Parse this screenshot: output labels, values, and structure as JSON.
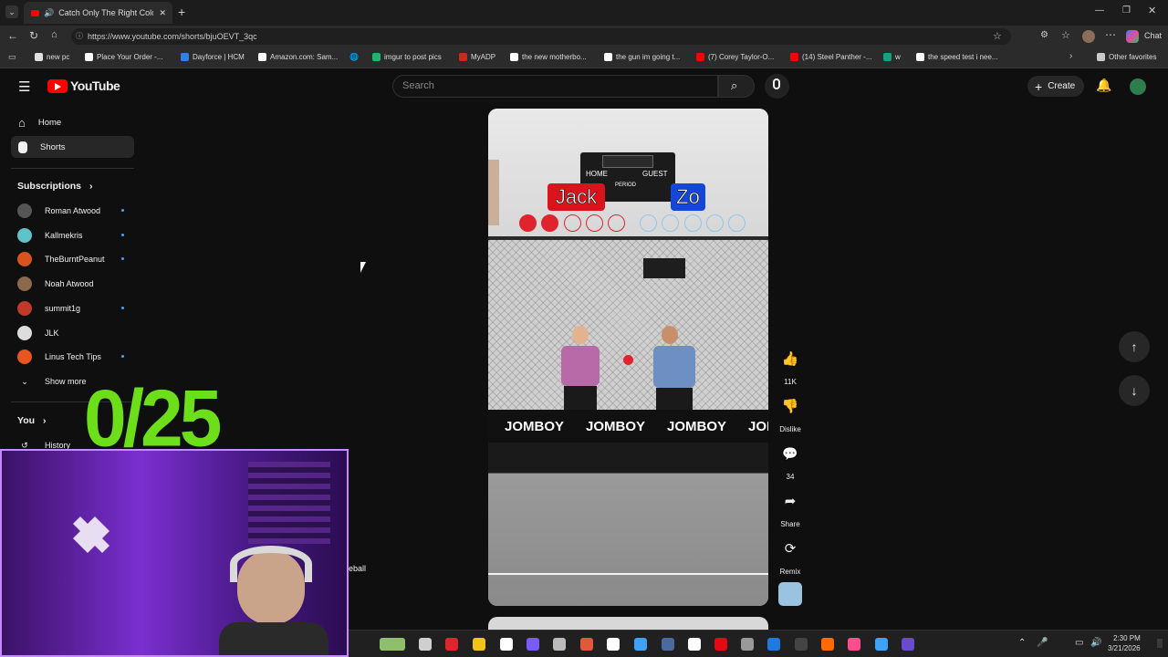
{
  "browser": {
    "tab_title": "Catch Only The Right Color B",
    "url": "https://www.youtube.com/shorts/bjuOEVT_3qc",
    "copilot_label": "Chat",
    "bookmarks": [
      {
        "label": "new pc",
        "color": "#e0e0e0"
      },
      {
        "label": "Place Your Order -...",
        "color": "#ffffff"
      },
      {
        "label": "Dayforce | HCM",
        "color": "#2f80ed"
      },
      {
        "label": "Amazon.com: Sam...",
        "color": "#ffffff"
      },
      {
        "label": "imgur to post pics",
        "color": "#1bb76e"
      },
      {
        "label": "MyADP",
        "color": "#d0271d"
      },
      {
        "label": "the new motherbo...",
        "color": "#ffffff"
      },
      {
        "label": "the gun im going t...",
        "color": "#ffffff"
      },
      {
        "label": "(7) Corey Taylor-O...",
        "color": "#ff0000"
      },
      {
        "label": "(14) Steel Panther -...",
        "color": "#ff0000"
      },
      {
        "label": "w",
        "color": "#10a37f"
      },
      {
        "label": "the speed test i nee...",
        "color": "#ffffff"
      }
    ],
    "other_favorites": "Other favorites"
  },
  "youtube": {
    "logo_text": "YouTube",
    "search_placeholder": "Search",
    "create_label": "Create",
    "sidebar": {
      "home": "Home",
      "shorts": "Shorts",
      "subscriptions_label": "Subscriptions",
      "subscriptions": [
        {
          "name": "Roman Atwood",
          "color": "#555555",
          "new": true
        },
        {
          "name": "Kallmekris",
          "color": "#5fc3c9",
          "new": true
        },
        {
          "name": "TheBurntPeanut",
          "color": "#d9531e",
          "new": true
        },
        {
          "name": "Noah Atwood",
          "color": "#8a6a4a",
          "new": false
        },
        {
          "name": "summit1g",
          "color": "#c0392b",
          "new": true
        },
        {
          "name": "JLK",
          "color": "#dddddd",
          "new": false
        },
        {
          "name": "Linus Tech Tips",
          "color": "#e8551e",
          "new": true
        }
      ],
      "show_more": "Show more",
      "you_label": "You",
      "history": "History",
      "partial_text": "eball"
    },
    "short": {
      "player_left": "Jack",
      "player_right": "Zo",
      "scoreboard_home": "HOME",
      "scoreboard_guest": "GUEST",
      "scoreboard_period": "PERIOD",
      "banner_text": "JOMBOY",
      "left_score_filled": 2,
      "left_score_total": 5,
      "right_score_total": 5
    },
    "actions": {
      "likes": "11K",
      "dislike": "Dislike",
      "comments": "34",
      "share": "Share",
      "remix": "Remix"
    }
  },
  "overlay": {
    "counter": "0/25"
  },
  "taskbar": {
    "time": "2:30 PM",
    "date": "3/21/2026"
  }
}
